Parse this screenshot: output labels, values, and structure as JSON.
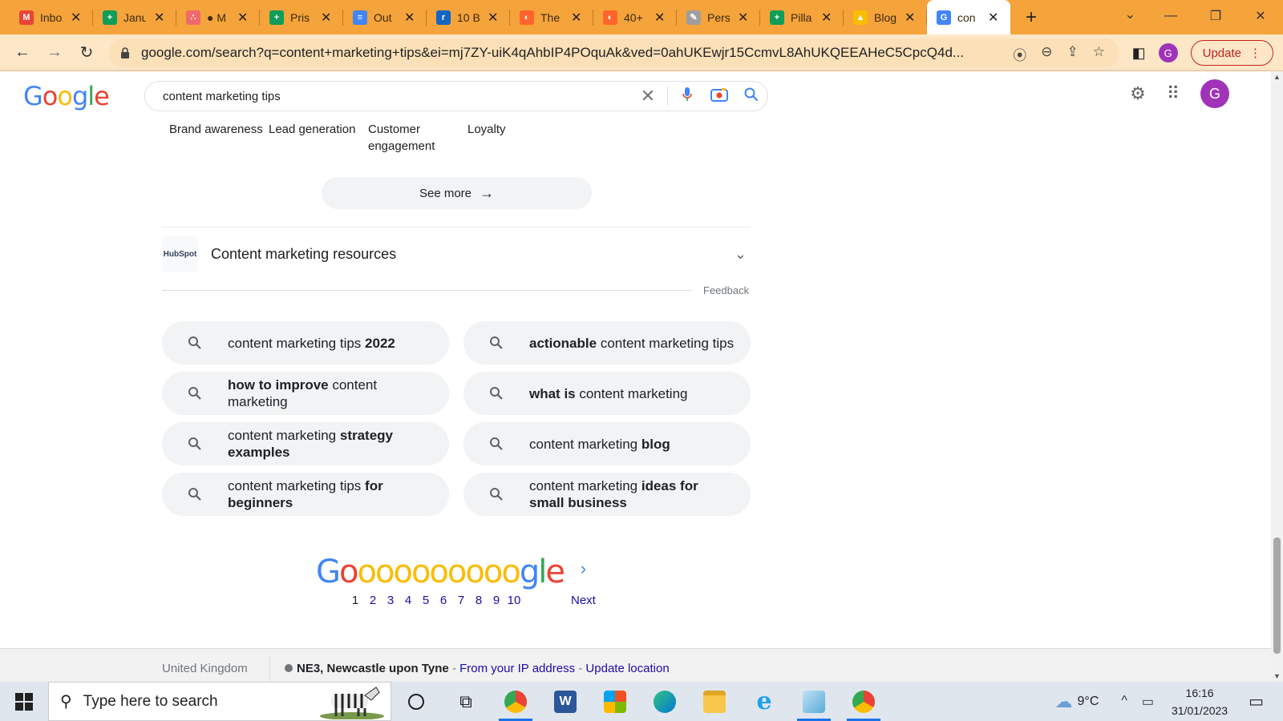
{
  "browser": {
    "tabs": [
      {
        "title": "Inbox",
        "favicon": "gmail-icon",
        "color": "#ea4335",
        "glyph": "M"
      },
      {
        "title": "Janu",
        "favicon": "sheets-icon",
        "color": "#0f9d58",
        "glyph": "+"
      },
      {
        "title": "● M",
        "favicon": "asana-icon",
        "color": "#f06a6a",
        "glyph": "∴"
      },
      {
        "title": "Pris",
        "favicon": "sheets-icon",
        "color": "#0f9d58",
        "glyph": "+"
      },
      {
        "title": "Out",
        "favicon": "docs-icon",
        "color": "#4285f4",
        "glyph": "≡"
      },
      {
        "title": "10 B",
        "favicon": "r-icon",
        "color": "#1565c0",
        "glyph": "r"
      },
      {
        "title": "The",
        "favicon": "semrush-icon",
        "color": "#ff642d",
        "glyph": "◐"
      },
      {
        "title": "40+",
        "favicon": "semrush-icon",
        "color": "#ff642d",
        "glyph": "◐"
      },
      {
        "title": "Pers",
        "favicon": "pen-icon",
        "color": "#9e9e9e",
        "glyph": "✎"
      },
      {
        "title": "Pilla",
        "favicon": "sheets-icon",
        "color": "#0f9d58",
        "glyph": "+"
      },
      {
        "title": "Blog",
        "favicon": "drive-icon",
        "color": "#fbbc04",
        "glyph": "▲"
      },
      {
        "title": "con",
        "favicon": "google-icon",
        "color": "#4285f4",
        "glyph": "G",
        "active": true
      }
    ],
    "url": "google.com/search?q=content+marketing+tips&ei=mj7ZY-uiK4qAhbIP4POquAk&ved=0ahUKEwjr15CcmvL8AhUKQEEAHeC5CpcQ4d...",
    "update_label": "Update",
    "profile_initial": "G"
  },
  "google": {
    "logo": [
      "G",
      "o",
      "o",
      "g",
      "l",
      "e"
    ],
    "query": "content marketing tips",
    "avatar_initial": "G"
  },
  "chips": [
    "Brand awareness",
    "Lead generation",
    "Customer engagement",
    "Loyalty"
  ],
  "see_more": "See more",
  "resources": {
    "logo_text": "HubSpot",
    "title": "Content marketing resources"
  },
  "feedback": "Feedback",
  "related": [
    [
      {
        "t": "content marketing tips ",
        "b": false
      },
      {
        "t": "2022",
        "b": true
      }
    ],
    [
      {
        "t": "actionable",
        "b": true
      },
      {
        "t": " content marketing tips",
        "b": false
      }
    ],
    [
      {
        "t": "how to improve",
        "b": true
      },
      {
        "t": " content marketing",
        "b": false
      }
    ],
    [
      {
        "t": "what is",
        "b": true
      },
      {
        "t": " content marketing",
        "b": false
      }
    ],
    [
      {
        "t": "content marketing ",
        "b": false
      },
      {
        "t": "strategy examples",
        "b": true
      }
    ],
    [
      {
        "t": "content marketing ",
        "b": false
      },
      {
        "t": "blog",
        "b": true
      }
    ],
    [
      {
        "t": "content marketing tips ",
        "b": false
      },
      {
        "t": "for beginners",
        "b": true
      }
    ],
    [
      {
        "t": "content marketing ",
        "b": false
      },
      {
        "t": "ideas for small business",
        "b": true
      }
    ]
  ],
  "pager": {
    "pages": [
      "1",
      "2",
      "3",
      "4",
      "5",
      "6",
      "7",
      "8",
      "9",
      "10"
    ],
    "current": "1",
    "next": "Next"
  },
  "footer": {
    "country": "United Kingdom",
    "location": "NE3, Newcastle upon Tyne",
    "sep1": " - ",
    "from_ip": "From your IP address",
    "sep2": " - ",
    "update_location": "Update location"
  },
  "taskbar": {
    "search_placeholder": "Type here to search",
    "temp": "9°C",
    "time": "16:16",
    "date": "31/01/2023"
  },
  "colors": {
    "google_blue": "#4285f4",
    "google_red": "#ea4335",
    "google_yellow": "#fbbc05",
    "google_green": "#34a853",
    "tabstrip": "#f5a33b"
  }
}
